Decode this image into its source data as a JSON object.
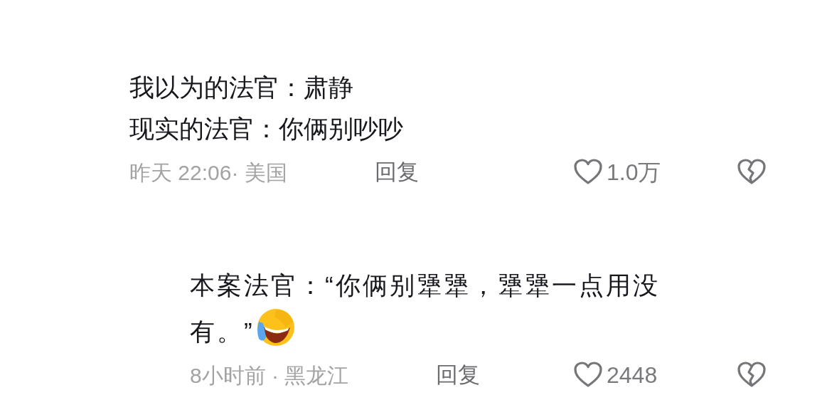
{
  "comments": [
    {
      "lines": [
        "我以为的法官：肃静",
        "现实的法官：你俩别吵吵"
      ],
      "meta": "昨天 22:06· 美国",
      "reply_label": "回复",
      "likes": "1.0万",
      "liked": false,
      "replies": [
        {
          "kind": "text-emoji",
          "lines": [
            "本案法官：“你俩别犟犟，犟犟一点用没",
            "有。”"
          ],
          "meta": "8小时前 · 黑龙江",
          "reply_label": "回复",
          "likes": "2448",
          "liked": false
        }
      ]
    }
  ]
}
